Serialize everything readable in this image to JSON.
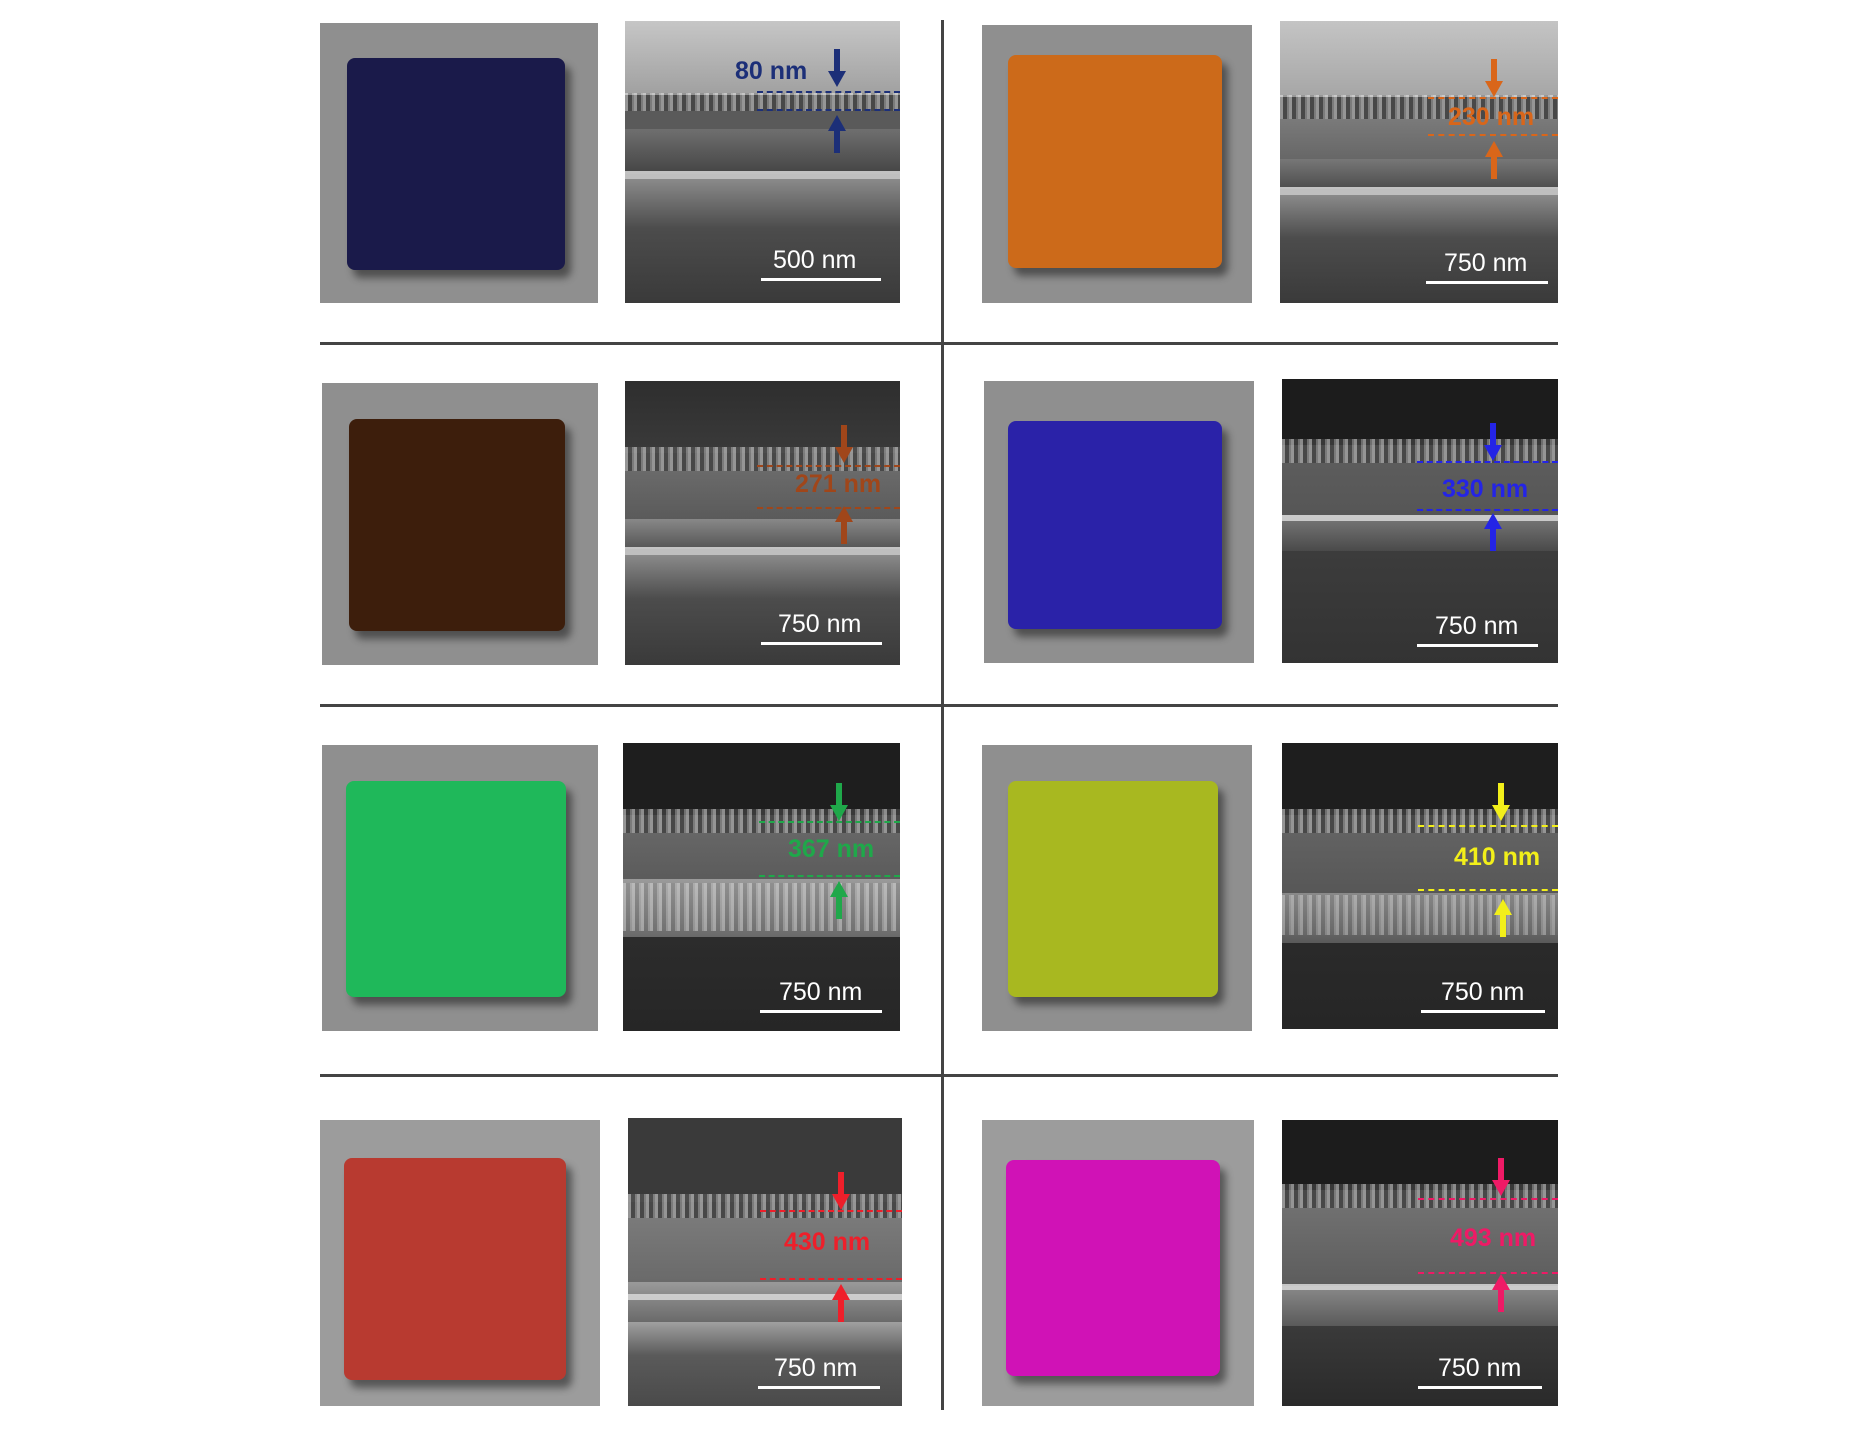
{
  "panels": [
    {
      "swatch_color": "#1a1a4a",
      "thickness_label": "80 nm",
      "label_color": "#1c2f78",
      "scale_label": "500 nm"
    },
    {
      "swatch_color": "#cc6a1a",
      "thickness_label": "230 nm",
      "label_color": "#d9661a",
      "scale_label": "750 nm"
    },
    {
      "swatch_color": "#3d1e0c",
      "thickness_label": "271 nm",
      "label_color": "#a0461a",
      "scale_label": "750 nm"
    },
    {
      "swatch_color": "#2a22a8",
      "thickness_label": "330  nm",
      "label_color": "#2424e6",
      "scale_label": "750 nm"
    },
    {
      "swatch_color": "#1fb85a",
      "thickness_label": "367 nm",
      "label_color": "#1fa84a",
      "scale_label": "750 nm"
    },
    {
      "swatch_color": "#a8b820",
      "thickness_label": "410 nm",
      "label_color": "#f2ef1a",
      "scale_label": "750 nm"
    },
    {
      "swatch_color": "#b83a30",
      "thickness_label": "430 nm",
      "label_color": "#ee1f2a",
      "scale_label": "750 nm"
    },
    {
      "swatch_color": "#d012b6",
      "thickness_label": "493 nm",
      "label_color": "#ee1a66",
      "scale_label": "750 nm"
    }
  ]
}
